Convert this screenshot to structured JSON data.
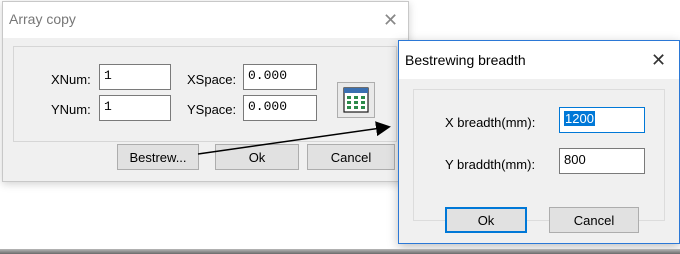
{
  "array_copy": {
    "title": "Array copy",
    "close_glyph": "✕",
    "xnum_label": "XNum:",
    "xnum_value": "1",
    "ynum_label": "YNum:",
    "ynum_value": "1",
    "xspace_label": "XSpace:",
    "xspace_value": "0.000",
    "yspace_label": "YSpace:",
    "yspace_value": "0.000",
    "grid_icon": "grid-icon",
    "bestrew_label": "Bestrew...",
    "ok_label": "Ok",
    "cancel_label": "Cancel"
  },
  "bestrewing": {
    "title": "Bestrewing breadth",
    "close_glyph": "✕",
    "x_label": "X breadth(mm):",
    "x_value": "1200",
    "y_label": "Y braddth(mm):",
    "y_value": "800",
    "ok_label": "Ok",
    "cancel_label": "Cancel"
  },
  "colors": {
    "accent": "#0078d7",
    "arrow": "#000000"
  }
}
